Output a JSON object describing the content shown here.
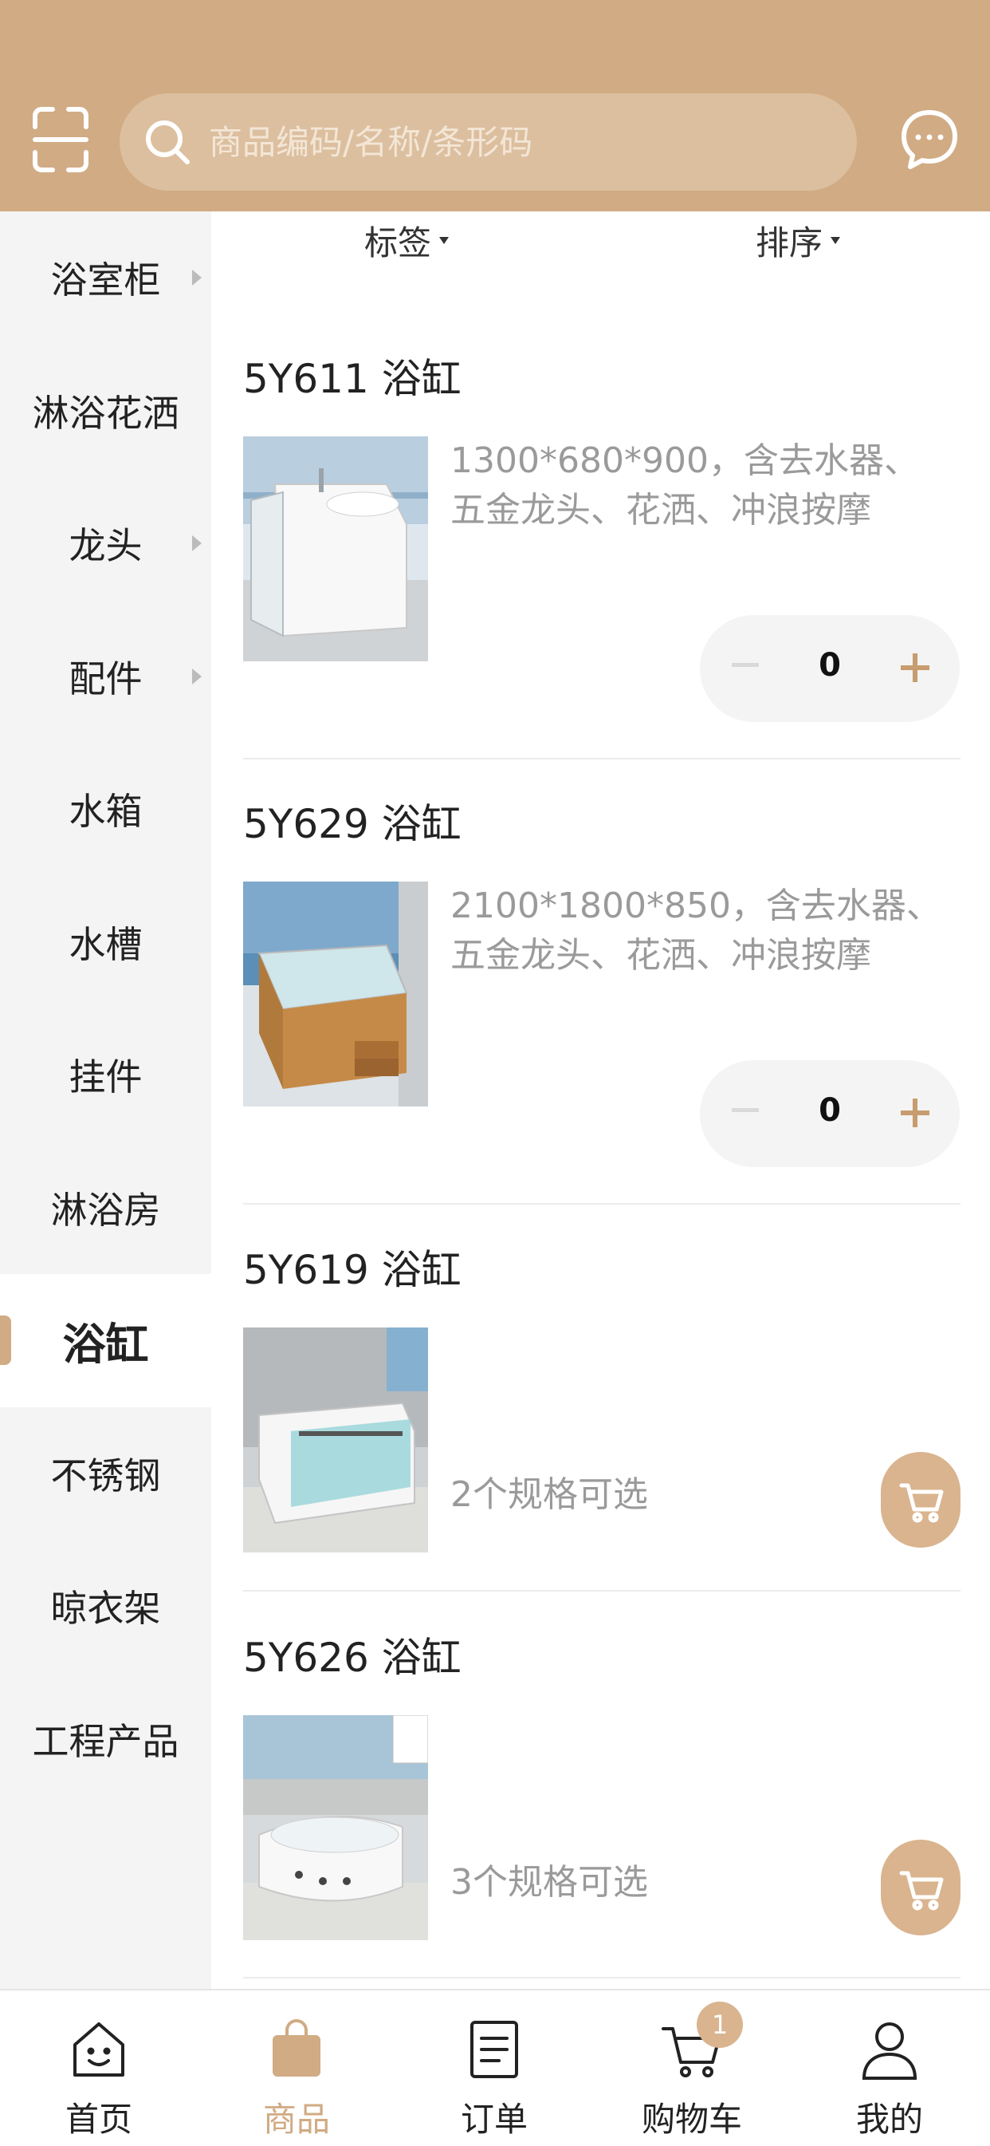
{
  "header": {
    "search_placeholder": "商品编码/名称/条形码",
    "accent_color": "#d0ab84"
  },
  "sidebar": {
    "items": [
      {
        "label": "浴室柜",
        "has_arrow": true
      },
      {
        "label": "淋浴花洒",
        "has_arrow": false
      },
      {
        "label": "龙头",
        "has_arrow": true
      },
      {
        "label": "配件",
        "has_arrow": true
      },
      {
        "label": "水箱",
        "has_arrow": false
      },
      {
        "label": "水槽",
        "has_arrow": false
      },
      {
        "label": "挂件",
        "has_arrow": false
      },
      {
        "label": "淋浴房",
        "has_arrow": false
      },
      {
        "label": "浴缸",
        "has_arrow": false,
        "active": true
      },
      {
        "label": "不锈钢",
        "has_arrow": false
      },
      {
        "label": "晾衣架",
        "has_arrow": false
      },
      {
        "label": "工程产品",
        "has_arrow": false
      }
    ]
  },
  "filters": {
    "tag_label": "标签",
    "sort_label": "排序"
  },
  "products": [
    {
      "title": "5Y611 浴缸",
      "desc": "1300*680*900，含去水器、五金龙头、花洒、冲浪按摩",
      "qty": "0"
    },
    {
      "title": "5Y629 浴缸",
      "desc": "2100*1800*850，含去水器、五金龙头、花洒、冲浪按摩",
      "qty": "0"
    },
    {
      "title": "5Y619 浴缸",
      "spec": "2个规格可选"
    },
    {
      "title": "5Y626 浴缸",
      "spec": "3个规格可选"
    }
  ],
  "bottom_nav": {
    "items": [
      {
        "label": "首页",
        "icon": "home-face-icon"
      },
      {
        "label": "商品",
        "icon": "shopping-bag-icon",
        "active": true
      },
      {
        "label": "订单",
        "icon": "order-document-icon"
      },
      {
        "label": "购物车",
        "icon": "cart-icon",
        "badge": "1"
      },
      {
        "label": "我的",
        "icon": "user-icon"
      }
    ]
  }
}
